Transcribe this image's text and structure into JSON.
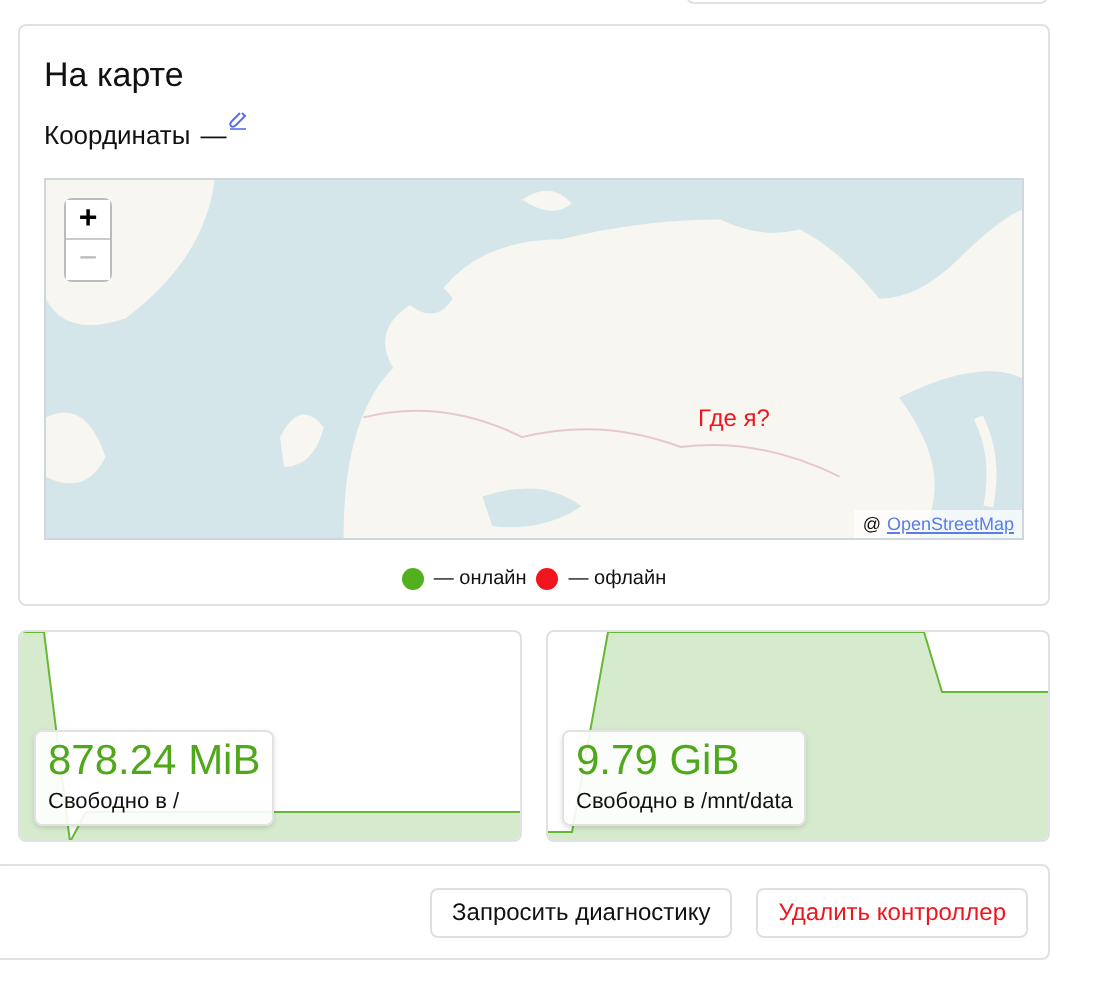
{
  "map_card": {
    "title": "На карте",
    "coordinates_label": "Координаты",
    "coordinates_value": "—",
    "map": {
      "zoom_in": {
        "label": "+",
        "disabled": false
      },
      "zoom_out": {
        "label": "−",
        "disabled": true
      },
      "marker_label": "Где я?",
      "attribution_prefix": "@",
      "attribution_link": "OpenStreetMap"
    },
    "legend": [
      {
        "label": "— онлайн",
        "color": "#52b01e"
      },
      {
        "label": "— офлайн",
        "color": "#f0141e"
      }
    ]
  },
  "stats": [
    {
      "value": "878.24 MiB",
      "label": "Свободно в /"
    },
    {
      "value": "9.79 GiB",
      "label": "Свободно в /mnt/data"
    }
  ],
  "actions": [
    {
      "label": "Запросить диагностику",
      "kind": "default"
    },
    {
      "label": "Удалить контроллер",
      "kind": "danger"
    }
  ]
}
